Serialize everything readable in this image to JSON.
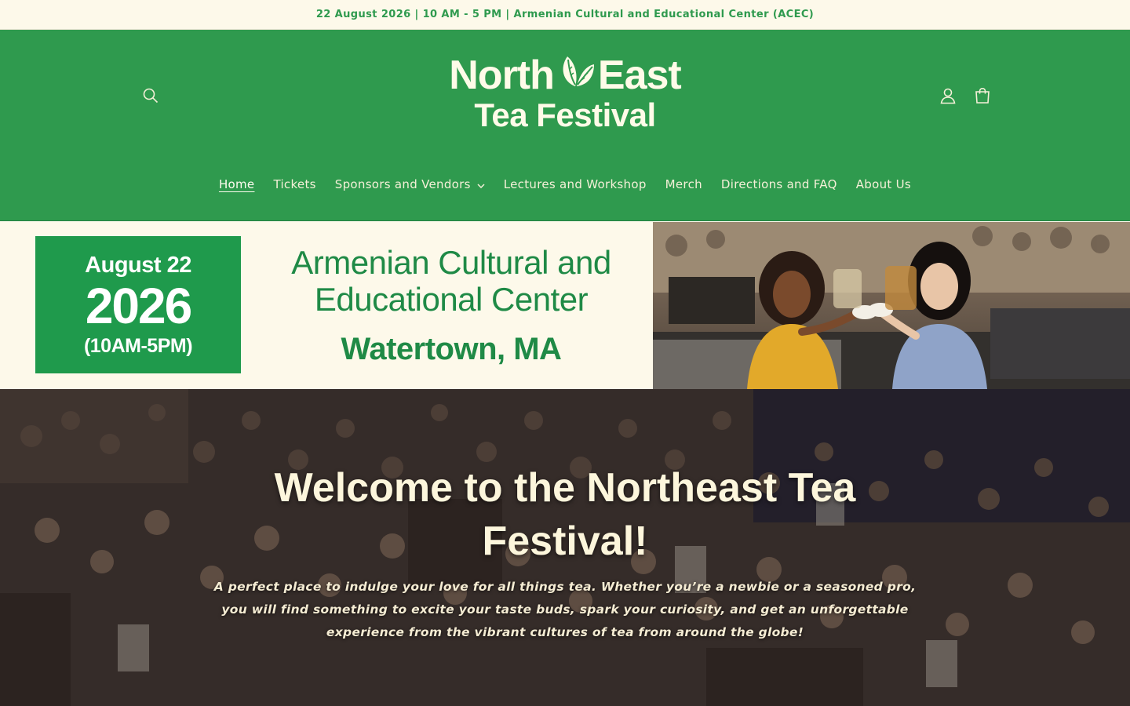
{
  "announcement": {
    "text": "22 August 2026 | 10 AM - 5 PM | Armenian Cultural and Educational Center (ACEC)"
  },
  "header": {
    "logo_line1_left": "North",
    "logo_line1_right": "East",
    "logo_line2": "Tea Festival",
    "icons": {
      "search": "search-icon",
      "account": "account-icon",
      "cart": "cart-icon"
    }
  },
  "nav": {
    "items": [
      {
        "label": "Home",
        "active": true
      },
      {
        "label": "Tickets"
      },
      {
        "label": "Sponsors and Vendors",
        "dropdown": true
      },
      {
        "label": "Lectures and Workshop"
      },
      {
        "label": "Merch"
      },
      {
        "label": "Directions and FAQ"
      },
      {
        "label": "About Us"
      }
    ]
  },
  "banner": {
    "date_month": "August 22",
    "date_year": "2026",
    "date_hours": "(10AM-5PM)",
    "venue_line1": "Armenian Cultural and",
    "venue_line2": "Educational Center",
    "venue_city": "Watertown, MA"
  },
  "hero": {
    "title": "Welcome to the Northeast Tea Festival!",
    "subtitle": "A perfect place to indulge your love for all things tea. Whether you’re a newbie or a seasoned pro, you will find something to excite your taste buds, spark your curiosity, and get an unforgettable experience from the vibrant cultures of tea from around the globe!"
  },
  "colors": {
    "brand_green": "#2f9a4e",
    "cream": "#fdf9ea",
    "dark_green": "#1f8a46"
  }
}
